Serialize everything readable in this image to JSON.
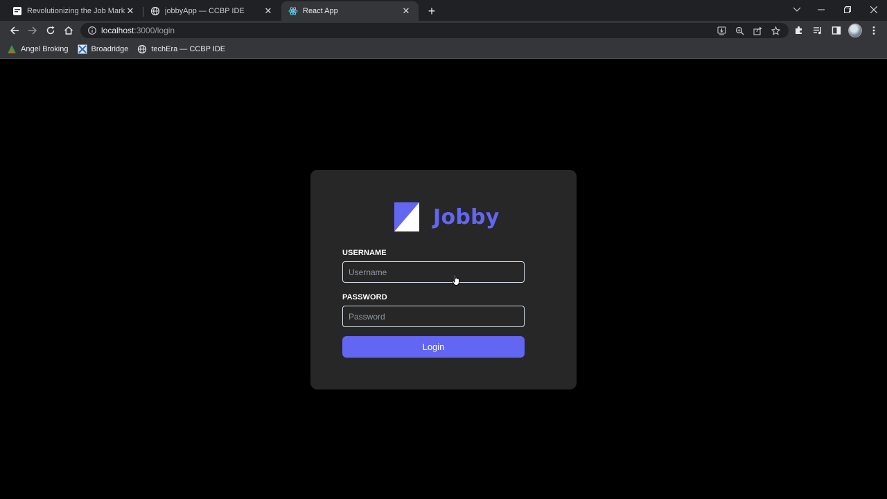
{
  "browser": {
    "tabs": [
      {
        "title": "Revolutionizing the Job Market | ",
        "active": false
      },
      {
        "title": "jobbyApp — CCBP IDE",
        "active": false
      },
      {
        "title": "React App",
        "active": true
      }
    ],
    "url": {
      "host": "localhost",
      "path": ":3000/login"
    },
    "bookmarks": [
      {
        "label": "Angel Broking",
        "icon": "angel-broking-icon"
      },
      {
        "label": "Broadridge",
        "icon": "broadridge-icon"
      },
      {
        "label": "techEra — CCBP IDE",
        "icon": "globe-icon"
      }
    ]
  },
  "login": {
    "brand": "Jobby",
    "brand_color": "#6366f1",
    "username_label": "USERNAME",
    "username_placeholder": "Username",
    "password_label": "PASSWORD",
    "password_placeholder": "Password",
    "button_label": "Login"
  }
}
